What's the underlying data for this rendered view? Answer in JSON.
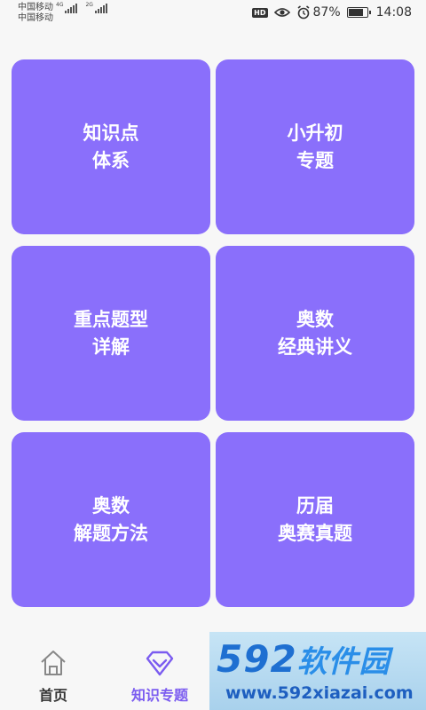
{
  "status_bar": {
    "carrier_1": "中国移动",
    "carrier_2": "中国移动",
    "net_1": "4G",
    "net_2": "2G",
    "battery_percent": "87%",
    "battery_level": 0.87,
    "time": "14:08",
    "hd_label": "HD"
  },
  "tiles": [
    {
      "line1": "知识点",
      "line2": "体系"
    },
    {
      "line1": "小升初",
      "line2": "专题"
    },
    {
      "line1": "重点题型",
      "line2": "详解"
    },
    {
      "line1": "奥数",
      "line2": "经典讲义"
    },
    {
      "line1": "奥数",
      "line2": "解题方法"
    },
    {
      "line1": "历届",
      "line2": "奥赛真题"
    }
  ],
  "tabs": {
    "home": "首页",
    "topics": "知识专题",
    "active_color": "#7b5cf0"
  },
  "watermark": {
    "logo_num": "592",
    "logo_cn": "软件园",
    "url": "www.592xiazai.com"
  },
  "colors": {
    "tile": "#8a6ffb",
    "background": "#f7f7f7"
  }
}
